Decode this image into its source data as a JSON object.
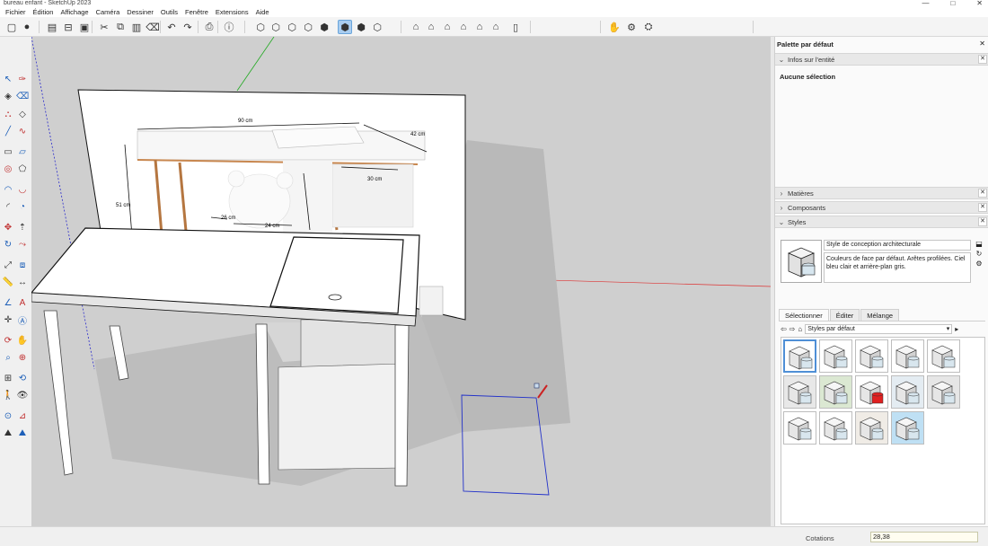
{
  "window": {
    "title": "bureau enfant - SketchUp 2023",
    "controls": [
      "—",
      "□",
      "✕"
    ]
  },
  "menu": [
    "Fichier",
    "Édition",
    "Affichage",
    "Caméra",
    "Dessiner",
    "Outils",
    "Fenêtre",
    "Extensions",
    "Aide"
  ],
  "toolbar": {
    "buttons": [
      {
        "name": "new-file-icon",
        "glyph": "▢"
      },
      {
        "name": "user-icon",
        "glyph": "●"
      },
      {
        "name": "open-icon",
        "glyph": "▤"
      },
      {
        "name": "open-folder-icon",
        "glyph": "⊟"
      },
      {
        "name": "save-icon",
        "glyph": "▣"
      },
      {
        "name": "cut-icon",
        "glyph": "✂"
      },
      {
        "name": "copy-icon",
        "glyph": "⧉"
      },
      {
        "name": "paste-icon",
        "glyph": "▥"
      },
      {
        "name": "delete-icon",
        "glyph": "⌫"
      },
      {
        "name": "undo-icon",
        "glyph": "↶"
      },
      {
        "name": "redo-icon",
        "glyph": "↷"
      },
      {
        "name": "print-icon",
        "glyph": "⎙"
      },
      {
        "name": "model-info-icon",
        "glyph": "ⓘ"
      },
      {
        "name": "xray-style-icon",
        "glyph": "⬡"
      },
      {
        "name": "back-edges-style-icon",
        "glyph": "⬡"
      },
      {
        "name": "wireframe-style-icon",
        "glyph": "⬡"
      },
      {
        "name": "hidden-line-style-icon",
        "glyph": "⬡"
      },
      {
        "name": "shaded-style-icon",
        "glyph": "⬢"
      },
      {
        "name": "shaded-textures-style-icon",
        "glyph": "⬢"
      },
      {
        "name": "monochrome-style-icon",
        "glyph": "⬢"
      },
      {
        "name": "iso-view-icon",
        "glyph": "⬡"
      },
      {
        "name": "top-view-icon",
        "glyph": "⌂"
      },
      {
        "name": "front-view-icon",
        "glyph": "⌂"
      },
      {
        "name": "right-view-icon",
        "glyph": "⌂"
      },
      {
        "name": "back-view-icon",
        "glyph": "⌂"
      },
      {
        "name": "left-view-icon",
        "glyph": "⌂"
      },
      {
        "name": "bottom-view-icon",
        "glyph": "⌂"
      },
      {
        "name": "section-plane-icon",
        "glyph": "▯"
      },
      {
        "name": "pan-hand-icon",
        "glyph": "✋"
      },
      {
        "name": "settings-gear-icon",
        "glyph": "⚙"
      },
      {
        "name": "extension-warehouse-icon",
        "glyph": "⛭"
      }
    ],
    "active_index": 18
  },
  "left_tools": [
    "select-icon",
    "lasso-icon",
    "paint-bucket-icon",
    "eraser-icon",
    "tag-icon",
    "eraser-alt-icon",
    "pencil-line-icon",
    "freehand-icon",
    "rectangle-icon",
    "rotated-rectangle-icon",
    "circle-icon",
    "polygon-icon",
    "arc-icon",
    "two-point-arc-icon",
    "three-point-arc-icon",
    "pie-icon",
    "move-icon",
    "push-pull-icon",
    "rotate-icon",
    "follow-me-icon",
    "scale-icon",
    "offset-icon",
    "tape-measure-icon",
    "dimension-icon",
    "protractor-icon",
    "text-icon",
    "axes-icon",
    "3d-text-icon",
    "orbit-icon",
    "pan-icon",
    "zoom-icon",
    "zoom-window-icon",
    "zoom-extents-icon",
    "previous-view-icon",
    "walk-icon",
    "look-around-icon",
    "position-camera-icon",
    "section-plane-tool-icon",
    "sandbox-icon",
    "sandbox-alt-icon"
  ],
  "image_labels": {
    "width": "90 cm",
    "depth": "42 cm",
    "height": "51 cm",
    "drawer": "30 cm",
    "small1": "26 cm",
    "small2": "24 cm"
  },
  "panel": {
    "title": "Palette par défaut",
    "entity_info": {
      "label": "Infos sur l'entité",
      "expanded": true,
      "content": "Aucune sélection"
    },
    "materials": {
      "label": "Matières",
      "expanded": false
    },
    "components": {
      "label": "Composants",
      "expanded": false
    },
    "styles": {
      "label": "Styles",
      "expanded": true,
      "style_name": "Style de conception architecturale",
      "style_description": "Couleurs de face par défaut. Arêtes profilées. Ciel bleu clair et arrière-plan gris.",
      "tabs": [
        "Sélectionner",
        "Éditer",
        "Mélange"
      ],
      "active_tab": 0,
      "library": "Styles par défaut",
      "thumbnail_count": 14,
      "selected_thumbnail": 0
    }
  },
  "status": {
    "measure_label": "Cotations",
    "measure_value": "28,38"
  },
  "colors": {
    "accent": "#4f8fd6",
    "axis_red": "#d33",
    "axis_green": "#2a2",
    "axis_blue": "#22c",
    "viewport": "#cfcfcf"
  }
}
